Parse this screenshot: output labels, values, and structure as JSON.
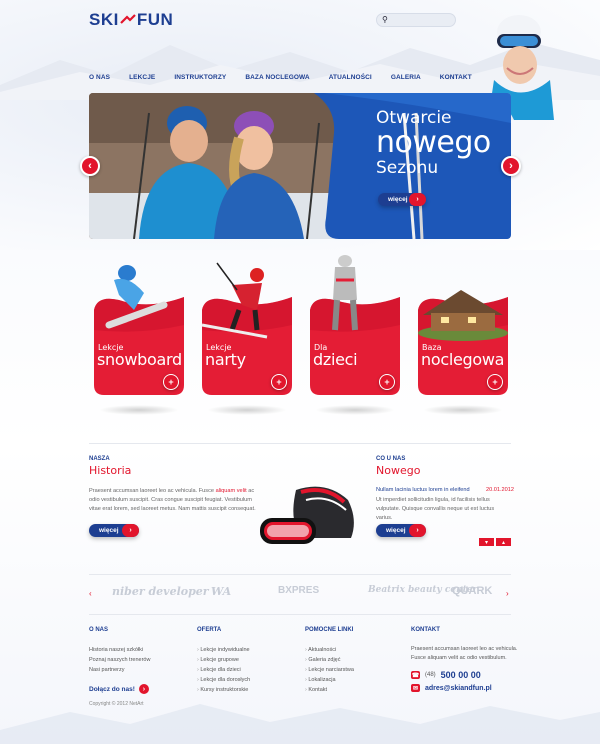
{
  "brand": {
    "left": "SKI",
    "right": "FUN"
  },
  "search": {
    "placeholder": ""
  },
  "nav": [
    "O NAS",
    "LEKCJE",
    "INSTRUKTORZY",
    "BAZA NOCLEGOWA",
    "ATUALNOŚCI",
    "GALERIA",
    "KONTAKT"
  ],
  "hero": {
    "line1": "Otwarcie",
    "line2": "nowego",
    "line3": "Sezonu",
    "button": "więcej"
  },
  "cards": [
    {
      "pre": "Lekcje",
      "main": "snowboard"
    },
    {
      "pre": "Lekcje",
      "main": "narty"
    },
    {
      "pre": "Dla",
      "main": "dzieci"
    },
    {
      "pre": "Baza",
      "main": "noclegowa"
    }
  ],
  "history": {
    "small": "NASZA",
    "big": "Historia",
    "text_before": "Praesent accumsan laoreet leo ac vehicula. Fusce",
    "text_highlight": "aliquam velit",
    "text_after": "ac odio vestibulum suscipit. Cras congue suscipit feugiat. Vestibulum vitae erat lorem, sed laoreet metus. Nam mattis suscipit consequat.",
    "button": "więcej"
  },
  "news": {
    "small": "CO U NAS",
    "big": "Nowego",
    "item_title": "Nullam lacinia luctus lorem in eleifend",
    "item_date": "20.01.2012",
    "item_text": "Ut imperdiet sollicitudin ligula, id facilisis tellus vulputate. Quisque convallis neque ut est luctus varius.",
    "button": "więcej"
  },
  "partners": [
    "niber developer",
    "WA",
    "BXPRES",
    "Beatrix beauty center",
    "QUARK"
  ],
  "footer": {
    "about": {
      "heading": "O NAS",
      "links": [
        "Historia naszej szkółki",
        "Poznaj naszych trenerów",
        "Nasi partnerzy"
      ]
    },
    "offer": {
      "heading": "OFERTA",
      "links": [
        "Lekcje indywidualne",
        "Lekcje grupowe",
        "Lekcje dla dzieci",
        "Lekcje dla dorosłych",
        "Kursy instruktorskie"
      ]
    },
    "help": {
      "heading": "POMOCNE LINKI",
      "links": [
        "Aktualności",
        "Galeria zdjęć",
        "Lekcje narciarstwa",
        "Lokalizacja",
        "Kontakt"
      ]
    },
    "contact": {
      "heading": "KONTAKT",
      "text1": "Praesent accumsan laoreet leo ac vehicula.",
      "text2": "Fusce aliquam velit ac odio vestibulum.",
      "phone_prefix": "(48)",
      "phone": "500 00 00",
      "email": "adres@skiandfun.pl"
    },
    "join": "Dołącz do nas!",
    "copyright": "Copyright © 2012 NetArt"
  },
  "colors": {
    "brand_blue": "#1d3e91",
    "accent_red": "#e2152c"
  }
}
